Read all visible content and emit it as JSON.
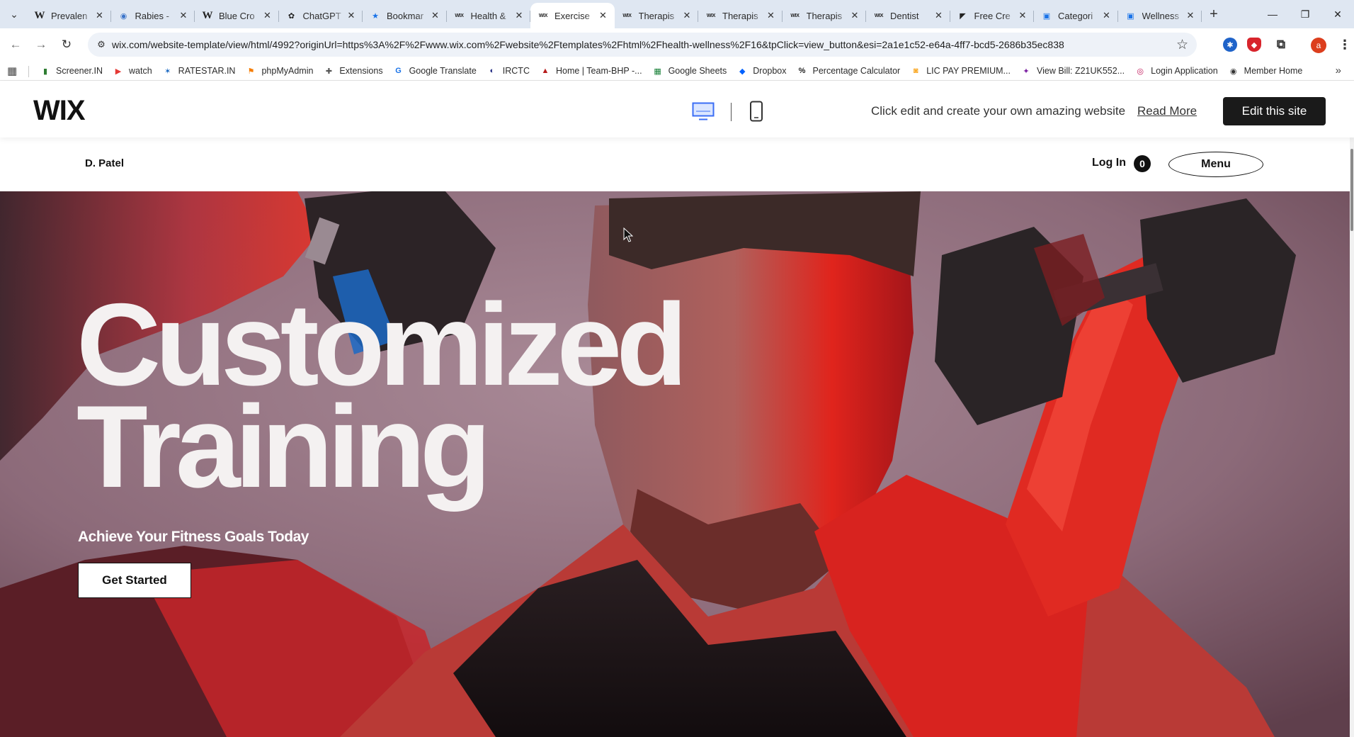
{
  "browser": {
    "tabs": [
      {
        "icon": "wikipedia-icon",
        "title": "Prevalen"
      },
      {
        "icon": "globe-icon",
        "title": "Rabies -"
      },
      {
        "icon": "wikipedia-icon",
        "title": "Blue Cro"
      },
      {
        "icon": "chatgpt-icon",
        "title": "ChatGPT"
      },
      {
        "icon": "bookmark-star-icon",
        "title": "Bookmar"
      },
      {
        "icon": "wix-icon",
        "title": "Health &"
      },
      {
        "icon": "wix-icon",
        "title": "Exercise",
        "active": true
      },
      {
        "icon": "wix-icon",
        "title": "Therapis"
      },
      {
        "icon": "wix-icon",
        "title": "Therapis"
      },
      {
        "icon": "wix-icon",
        "title": "Therapis"
      },
      {
        "icon": "wix-icon",
        "title": "Dentist"
      },
      {
        "icon": "framer-icon",
        "title": "Free Cre"
      },
      {
        "icon": "wix-editor-icon",
        "title": "Categori"
      },
      {
        "icon": "wix-editor-icon",
        "title": "Wellness"
      }
    ],
    "url": "wix.com/website-template/view/html/4992?originUrl=https%3A%2F%2Fwww.wix.com%2Fwebsite%2Ftemplates%2Fhtml%2Fhealth-wellness%2F16&tpClick=view_button&esi=2a1e1c52-e64a-4ff7-bcd5-2686b35ec838",
    "profile_initial": "a",
    "bookmarks": [
      {
        "label": "Screener.IN",
        "icon": "bar-chart-icon",
        "color": "#2e7d32"
      },
      {
        "label": "watch",
        "icon": "youtube-icon",
        "color": "#e53935"
      },
      {
        "label": "RATESTAR.IN",
        "icon": "star-burst-icon",
        "color": "#1565c0"
      },
      {
        "label": "phpMyAdmin",
        "icon": "phpmyadmin-icon",
        "color": "#f57c00"
      },
      {
        "label": "Extensions",
        "icon": "puzzle-icon",
        "color": "#555555"
      },
      {
        "label": "Google Translate",
        "icon": "translate-icon",
        "color": "#1a73e8"
      },
      {
        "label": "IRCTC",
        "icon": "irctc-icon",
        "color": "#1a237e"
      },
      {
        "label": "Home | Team-BHP -...",
        "icon": "teambhp-icon",
        "color": "#b71c1c"
      },
      {
        "label": "Google Sheets",
        "icon": "sheets-icon",
        "color": "#188038"
      },
      {
        "label": "Dropbox",
        "icon": "dropbox-icon",
        "color": "#0061fe"
      },
      {
        "label": "Percentage Calculator",
        "icon": "percent-icon",
        "color": "#222222"
      },
      {
        "label": "LIC PAY PREMIUM...",
        "icon": "lic-icon",
        "color": "#f9a825"
      },
      {
        "label": "View Bill: Z21UK552...",
        "icon": "bill-icon",
        "color": "#7b1fa2"
      },
      {
        "label": "Login Application",
        "icon": "login-app-icon",
        "color": "#c2185b"
      },
      {
        "label": "Member Home",
        "icon": "member-home-icon",
        "color": "#333333"
      }
    ]
  },
  "wixbar": {
    "logo": "WIX",
    "promo": "Click edit and create your own amazing website",
    "read_more": "Read More",
    "edit_button": "Edit this site"
  },
  "site": {
    "brand": "D. Patel",
    "login": "Log In",
    "cart_count": "0",
    "menu": "Menu",
    "hero": {
      "title_line1": "Customized",
      "title_line2": "Training",
      "subtitle": "Achieve Your Fitness Goals Today",
      "cta": "Get Started"
    }
  },
  "colors": {
    "hero_bg": "#8a6876",
    "accent_red": "#d8231f",
    "tabstrip": "#dfe7f2",
    "edit_button": "#1a1a1a"
  }
}
